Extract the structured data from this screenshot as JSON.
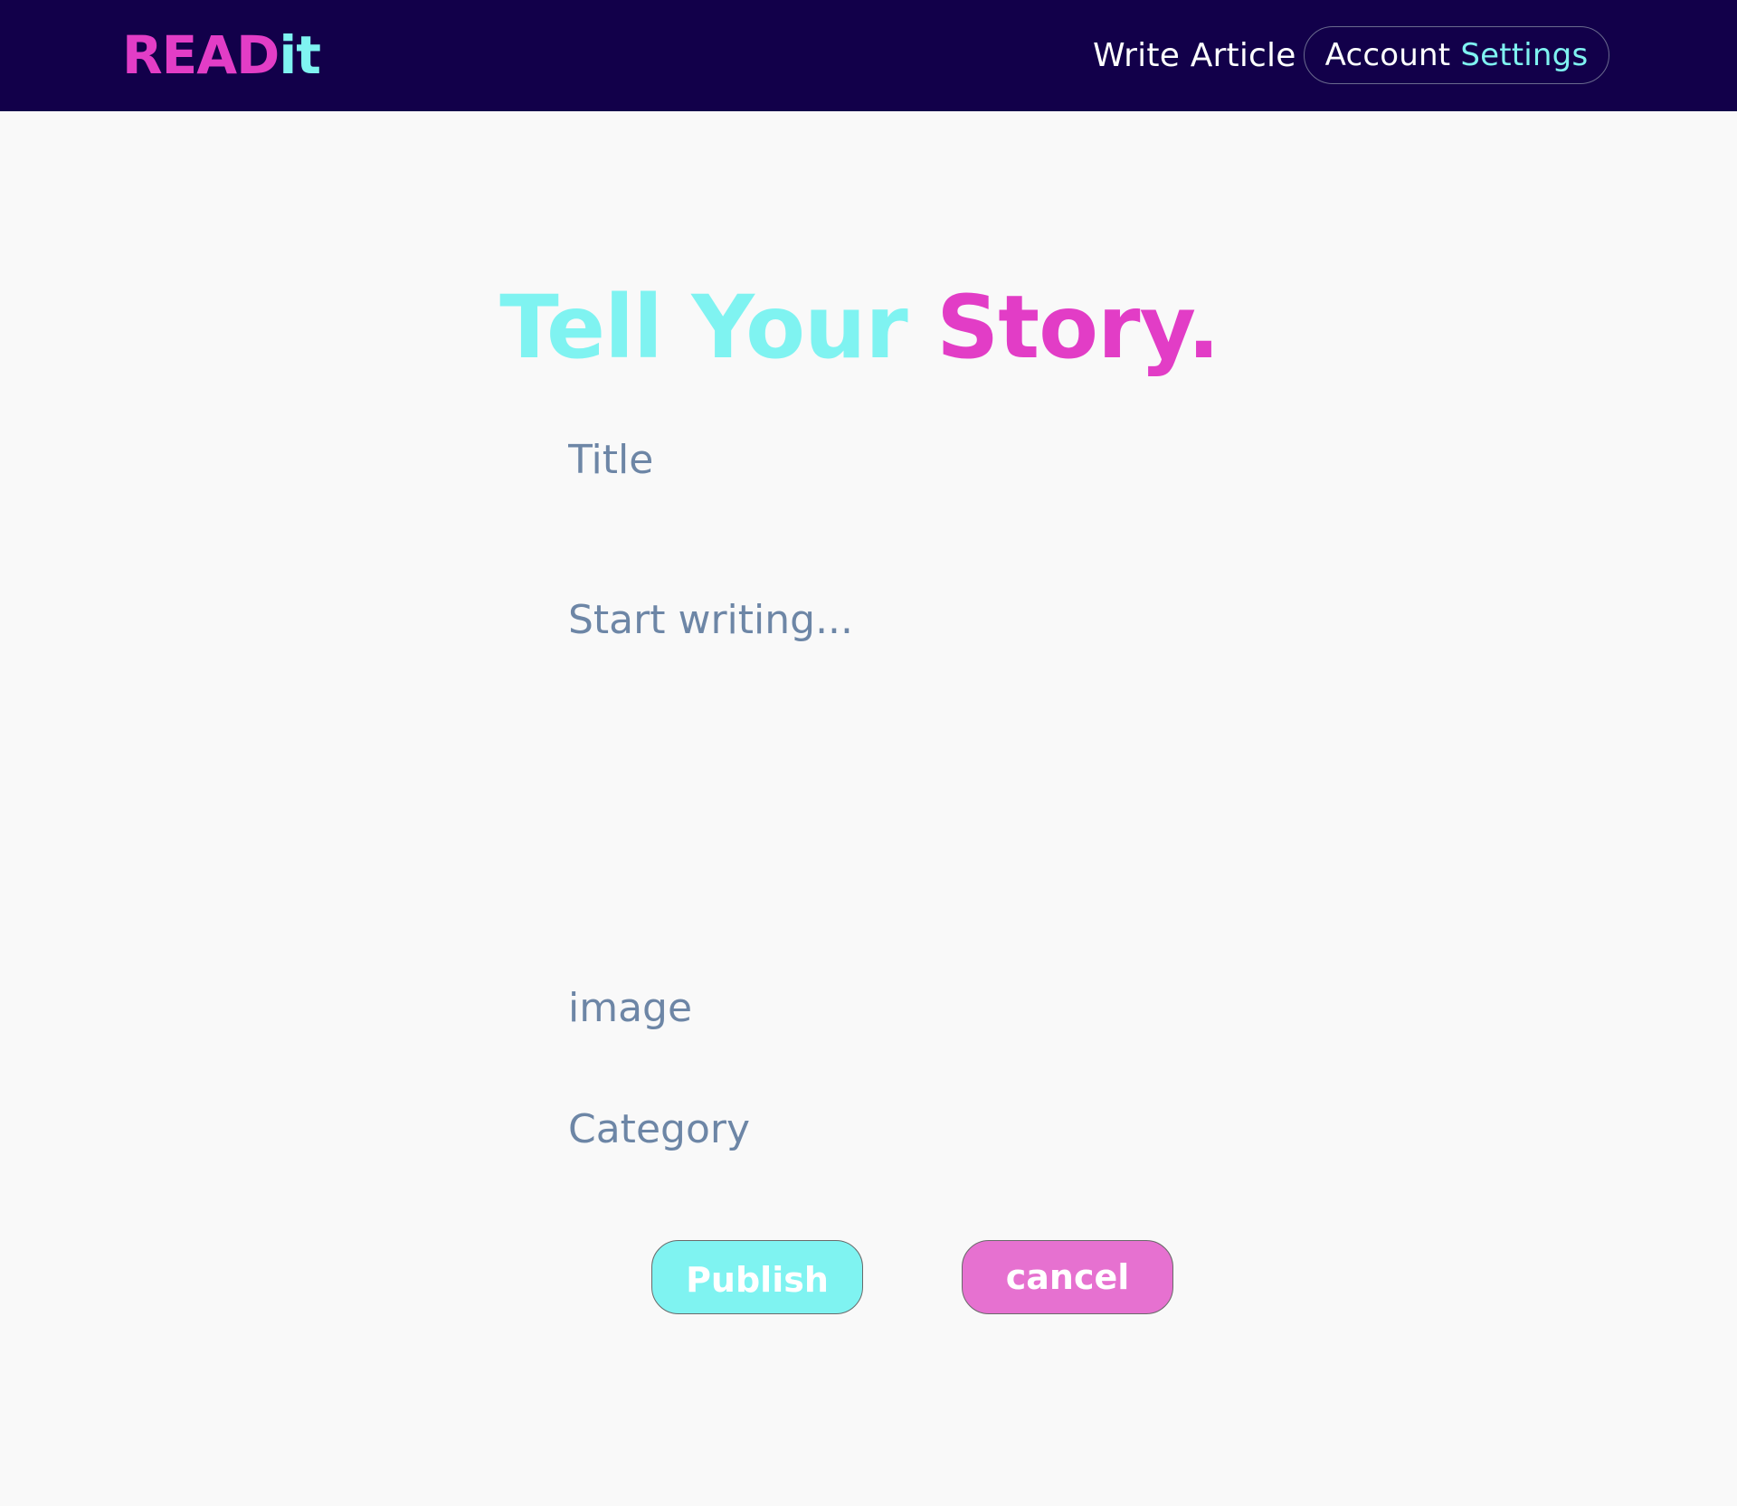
{
  "brand": {
    "part1": "READ",
    "part2": "it",
    "color1": "#e23dc6",
    "color2": "#7ff3f1"
  },
  "nav": {
    "write_article": "Write Article",
    "account_part1": "Account",
    "account_part2": "Settings"
  },
  "headline": {
    "part1": "Tell Your",
    "part2": "Story."
  },
  "form": {
    "title_placeholder": "Title",
    "body_placeholder": "Start writing...",
    "image_placeholder": "image",
    "category_placeholder": "Category",
    "title_value": "",
    "body_value": "",
    "image_value": "",
    "category_value": ""
  },
  "actions": {
    "publish_label": "Publish",
    "cancel_label": "cancel"
  },
  "colors": {
    "navbar_bg": "#12004a",
    "accent_cyan": "#7ff3f1",
    "accent_magenta": "#e23dc6",
    "cancel_bg": "#e671d0",
    "placeholder": "#6d86a6",
    "page_bg": "#f9f9f9"
  }
}
